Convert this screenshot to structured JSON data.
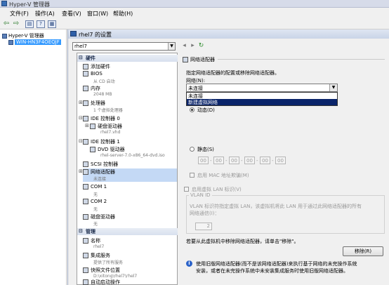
{
  "app": {
    "title": "Hyper-V 管理器"
  },
  "menu": [
    "文件(F)",
    "操作(A)",
    "查看(V)",
    "窗口(W)",
    "帮助(H)"
  ],
  "tree": {
    "root": "Hyper-V 管理器",
    "server": "WIN-HN3F4OEQJF"
  },
  "dialog": {
    "title": "rhel7 的设置",
    "vm_select": "rhel7"
  },
  "settings": {
    "hardware_header": "硬件",
    "add_hardware": "添加硬件",
    "bios": "BIOS",
    "bios_sub": "从 CD 启动",
    "memory": "内存",
    "memory_sub": "2048 MB",
    "processor": "处理器",
    "processor_sub": "1 个虚拟处理器",
    "ide0": "IDE 控制器 0",
    "hdd": "硬盘驱动器",
    "hdd_sub": "rhel7.vhd",
    "ide1": "IDE 控制器 1",
    "dvd": "DVD 驱动器",
    "dvd_sub": "rhel-server-7.0-x86_64-dvd.iso",
    "scsi": "SCSI 控制器",
    "nic": "网络适配器",
    "nic_sub": "未连接",
    "com1": "COM 1",
    "com1_sub": "无",
    "com2": "COM 2",
    "com2_sub": "无",
    "floppy": "磁盘驱动器",
    "floppy_sub": "无",
    "management_header": "管理",
    "name": "名称",
    "name_sub": "rhel7",
    "integration": "集成服务",
    "integration_sub": "提供了所有服务",
    "snapshot": "快照文件位置",
    "snapshot_sub": "D:\\xitong\\rhel7\\rhel7",
    "autostart": "自动启动操作"
  },
  "detail": {
    "header": "网络适配器",
    "description": "指定网络适配器的配置或移除网络适配器。",
    "network_label": "网络(N):",
    "network_value": "未连接",
    "dropdown_options": [
      "未连接",
      "新建虚拟网络"
    ],
    "mac_dynamic": "动态(D)",
    "mac_static": "静态(S)",
    "mac_values": [
      "00",
      "00",
      "00",
      "00",
      "00",
      "00"
    ],
    "mac_spoof": "启用 MAC 地址欺骗(M)",
    "vlan_enable": "启用虚拟 LAN 标识(V)",
    "vlan_id_label": "VLAN ID",
    "vlan_desc_1": "VLAN 标识符指定虚拟 LAN，该虚拟机将此 LAN 用于通过此网络适配器的所有",
    "vlan_desc_2": "网络通信(I)：",
    "vlan_value": "2",
    "remove_desc": "若要从此虚拟机中移除网络适配器，请单击\"移除\"。",
    "remove_button": "移除(R)",
    "info_1": "使用旧版网络适配器(而不是该网络适配器)来执行基于网络的未完操作系统",
    "info_2": "安装，或者在未完操作系统中未安装集成服务时使用旧版网络适配器。"
  }
}
